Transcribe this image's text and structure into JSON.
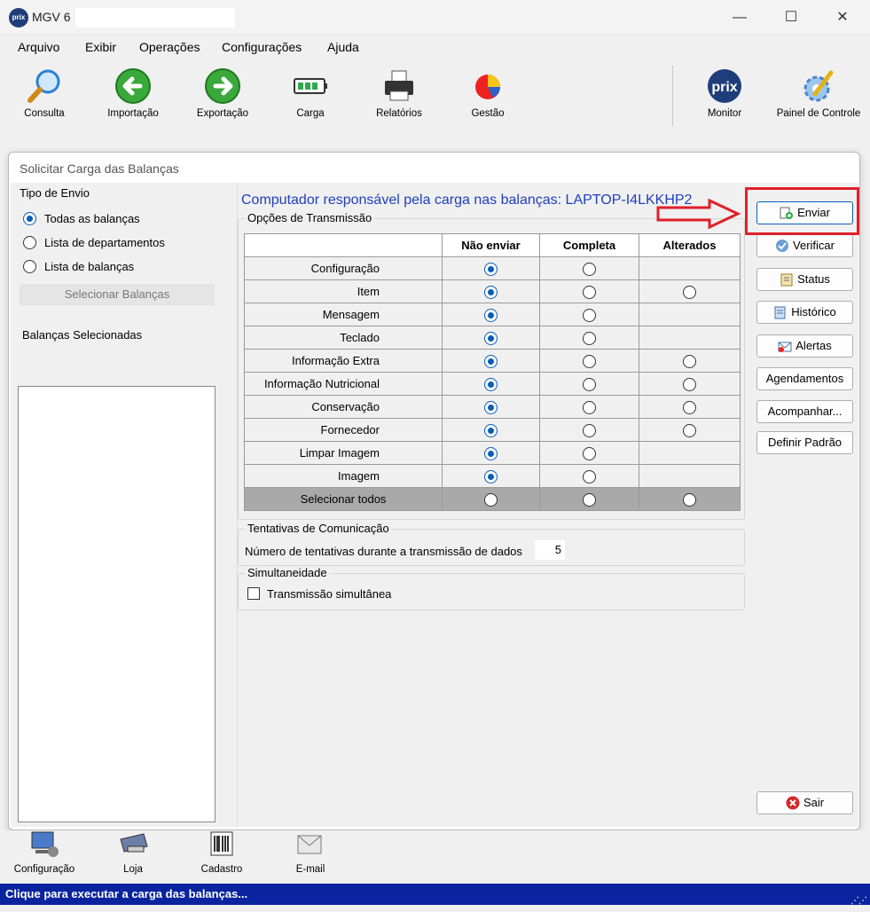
{
  "window": {
    "title": "MGV 6",
    "logo": "prix",
    "minimize": "—",
    "maximize": "☐",
    "close": "✕"
  },
  "menu": [
    "Arquivo",
    "Exibir",
    "Operações",
    "Configurações",
    "Ajuda"
  ],
  "toolbar": [
    {
      "label": "Consulta",
      "icon": "magnifier-icon"
    },
    {
      "label": "Importação",
      "icon": "arrow-left-icon"
    },
    {
      "label": "Exportação",
      "icon": "arrow-right-icon"
    },
    {
      "label": "Carga",
      "icon": "battery-icon"
    },
    {
      "label": "Relatórios",
      "icon": "printer-icon"
    },
    {
      "label": "Gestão",
      "icon": "pie-chart-icon"
    },
    {
      "label": "Monitor",
      "icon": "prix-icon",
      "logo_text": "prix"
    },
    {
      "label": "Painel de Controle",
      "icon": "control-panel-icon"
    }
  ],
  "dialog": {
    "title": "Solicitar Carga das Balanças",
    "tipo_envio": {
      "label": "Tipo de Envio",
      "options": [
        "Todas as balanças",
        "Lista de departamentos",
        "Lista de balanças"
      ],
      "selected": 0
    },
    "select_button": "Selecionar Balanças",
    "selected_label": "Balanças Selecionadas",
    "responsible": "Computador responsável pela carga nas balanças: LAPTOP-I4LKKHP2",
    "opcoes": {
      "legend": "Opções de Transmissão",
      "headers": [
        "",
        "Não enviar",
        "Completa",
        "Alterados"
      ],
      "rows": [
        {
          "name": "Configuração",
          "completa": true,
          "alterados": false
        },
        {
          "name": "Item",
          "completa": true,
          "alterados": true
        },
        {
          "name": "Mensagem",
          "completa": true,
          "alterados": false
        },
        {
          "name": "Teclado",
          "completa": true,
          "alterados": false
        },
        {
          "name": "Informação Extra",
          "completa": true,
          "alterados": true
        },
        {
          "name": "Informação Nutricional",
          "completa": true,
          "alterados": true
        },
        {
          "name": "Conservação",
          "completa": true,
          "alterados": true
        },
        {
          "name": "Fornecedor",
          "completa": true,
          "alterados": true
        },
        {
          "name": "Limpar Imagem",
          "completa": true,
          "alterados": false
        },
        {
          "name": "Imagem",
          "completa": true,
          "alterados": false
        }
      ],
      "select_all": "Selecionar todos"
    },
    "tentativas": {
      "legend": "Tentativas de Comunicação",
      "label": "Número de tentativas durante a transmissão de dados",
      "value": "5"
    },
    "simultaneidade": {
      "legend": "Simultaneidade",
      "checkbox_label": "Transmissão simultânea",
      "checked": false
    },
    "buttons": [
      {
        "label": "Enviar",
        "icon": "send-icon"
      },
      {
        "label": "Verificar",
        "icon": "verify-icon"
      },
      {
        "label": "Status",
        "icon": "clipboard-icon"
      },
      {
        "label": "Histórico",
        "icon": "history-icon"
      },
      {
        "label": "Alertas",
        "icon": "alert-mail-icon"
      },
      {
        "label": "Agendamentos",
        "icon": ""
      },
      {
        "label": "Acompanhar...",
        "icon": ""
      },
      {
        "label": "Definir Padrão",
        "icon": ""
      }
    ],
    "exit_button": "Sair"
  },
  "bottom_toolbar": [
    {
      "label": "Configuração",
      "icon": "computer-settings-icon"
    },
    {
      "label": "Loja",
      "icon": "scale-icon"
    },
    {
      "label": "Cadastro",
      "icon": "barcode-icon"
    },
    {
      "label": "E-mail",
      "icon": "envelope-icon"
    }
  ],
  "status": "Clique para executar a carga das balanças...",
  "colors": {
    "accent": "#0a5cb8",
    "statusbar": "#0a24a0",
    "highlight": "#e0202a",
    "link": "#1f3fbf"
  }
}
